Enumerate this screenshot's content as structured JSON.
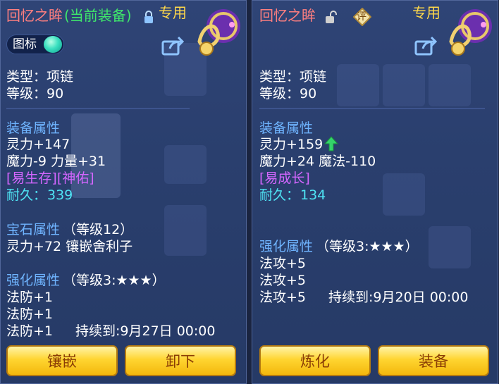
{
  "left_panel": {
    "title": "回忆之眸",
    "status": "(当前装备)",
    "badge": "专用",
    "toggle_label": "图标",
    "type_line": "类型：项链",
    "level_line": "等级：90",
    "equip_attr_header": "装备属性",
    "attr_line1": "灵力+147",
    "attr_line2": "魔力-9 力量+31",
    "special_line": "[易生存][神佑]",
    "durability_label": "耐久：",
    "durability_value": "339",
    "gem_header": "宝石属性",
    "gem_level": "（等级12）",
    "gem_line": "灵力+72 镶嵌舍利子",
    "enhance_header": "强化属性",
    "enhance_level": "（等级3:★★★）",
    "enhance_lines": [
      "法防+1",
      "法防+1",
      "法防+1"
    ],
    "enhance_duration": "持续到:9月27日 00:00",
    "buttons": [
      "镶嵌",
      "卸下"
    ]
  },
  "right_panel": {
    "title": "回忆之眸",
    "eval_badge": "评",
    "badge": "专用",
    "type_line": "类型：项链",
    "level_line": "等级：90",
    "equip_attr_header": "装备属性",
    "attr_line1": "灵力+159",
    "attr_line2": "魔力+24 魔法-110",
    "special_line": "[易成长]",
    "durability_label": "耐久：",
    "durability_value": "134",
    "enhance_header": "强化属性",
    "enhance_level": "（等级3:★★★）",
    "enhance_lines": [
      "法攻+5",
      "法攻+5",
      "法攻+5"
    ],
    "enhance_duration": "持续到:9月20日 00:00",
    "buttons": [
      "炼化",
      "装备"
    ]
  },
  "colors": {
    "title": "#ff7f7f",
    "equipped": "#3fe86b",
    "badge": "#ffd84a",
    "header_blue": "#6fb4ff",
    "special_purple": "#d466ff",
    "durability_cyan": "#4fe4f4",
    "button_gold": "#ffd531"
  },
  "icons": {
    "lock_closed": "lock-icon",
    "lock_open": "unlock-icon",
    "share": "share-icon",
    "upgrade": "green-up-arrow-icon",
    "necklace": "necklace-item-icon"
  }
}
